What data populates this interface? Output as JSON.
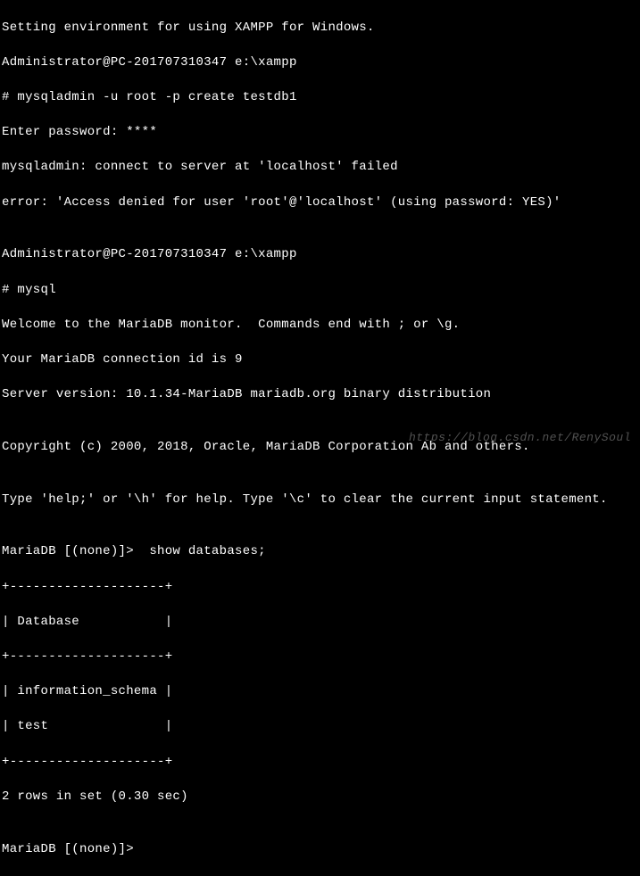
{
  "lines": {
    "l0": "Setting environment for using XAMPP for Windows.",
    "l1": "Administrator@PC-201707310347 e:\\xampp",
    "l2": "# mysqladmin -u root -p create testdb1",
    "l3": "Enter password: ****",
    "l4": "mysqladmin: connect to server at 'localhost' failed",
    "l5": "error: 'Access denied for user 'root'@'localhost' (using password: YES)'",
    "l6": "",
    "l7": "Administrator@PC-201707310347 e:\\xampp",
    "l8": "# mysql",
    "l9": "Welcome to the MariaDB monitor.  Commands end with ; or \\g.",
    "l10": "Your MariaDB connection id is 9",
    "l11": "Server version: 10.1.34-MariaDB mariadb.org binary distribution",
    "l12": "",
    "l13": "Copyright (c) 2000, 2018, Oracle, MariaDB Corporation Ab and others.",
    "l14": "",
    "l15": "Type 'help;' or '\\h' for help. Type '\\c' to clear the current input statement.",
    "l16": "",
    "l17": "MariaDB [(none)]>  show databases;",
    "l18": "+--------------------+",
    "l19": "| Database           |",
    "l20": "+--------------------+",
    "l21": "| information_schema |",
    "l22": "| test               |",
    "l23": "+--------------------+",
    "l24": "2 rows in set (0.30 sec)",
    "l25": "",
    "l26": "MariaDB [(none)]>"
  },
  "watermark": "https://blog.csdn.net/RenySoul"
}
